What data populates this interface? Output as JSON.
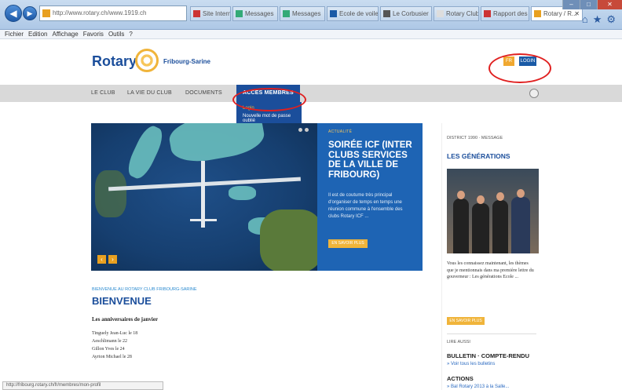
{
  "browser": {
    "address": "http://www.rotary.ch/www.1919.ch",
    "tabs": [
      {
        "label": "Site Internet",
        "active": false
      },
      {
        "label": "Messages",
        "active": false
      },
      {
        "label": "Messages",
        "active": false
      },
      {
        "label": "Ecole de voile",
        "active": false
      },
      {
        "label": "Le Corbusier",
        "active": false
      },
      {
        "label": "Rotary Club",
        "active": false
      },
      {
        "label": "Rapport des",
        "active": false
      },
      {
        "label": "Rotary / R...",
        "active": true
      }
    ],
    "menu": [
      "Fichier",
      "Edition",
      "Affichage",
      "Favoris",
      "Outils",
      "?"
    ],
    "window_controls": [
      "–",
      "□",
      "✕"
    ],
    "right_icons": [
      "home-icon",
      "star-icon",
      "gear-icon"
    ],
    "status_text": "http://fribourg.rotary.ch/fr/membres/mon-profil"
  },
  "site": {
    "logo_text": "Rotary",
    "logo_club": "Fribourg-Sarine",
    "lang": "FR",
    "login_label": "LOGIN",
    "nav": [
      {
        "label": "LE CLUB",
        "active": false
      },
      {
        "label": "LA VIE DU CLUB",
        "active": false
      },
      {
        "label": "DOCUMENTS",
        "active": false
      },
      {
        "label": "ACCÈS MEMBRES",
        "active": true
      }
    ],
    "dropdown": {
      "item1": "Login",
      "item2": "Nouvelle mot de passe oublié"
    },
    "hero": {
      "kicker": "ACTUALITÉ",
      "title": "SOIRÉE ICF (INTER CLUBS SERVICES DE LA VILLE DE FRIBOURG)",
      "text": "Il est de coutume très principal d'organiser de temps en temps une réunion commune à l'ensemble des clubs Rotary ICF ...",
      "button": "EN SAVOIR PLUS",
      "prev": "‹",
      "next": "›"
    },
    "welcome": {
      "kicker": "BIENVENUE AU ROTARY CLUB FRIBOURG-SARINE",
      "title": "BIENVENUE",
      "bold_line": "Les anniversaires de janvier",
      "birthdays": [
        "Tinguely Jean-Luc le 18",
        "Aeschlimann le 22",
        "Gillon Yves le 24",
        "Ayrton Michael le 28"
      ]
    },
    "sidebar": {
      "kicker": "DISTRICT 1990 · MESSAGE",
      "title": "LES GÉNÉRATIONS",
      "text": "Vous les connaissez maintenant, les thèmes que je mentionnais dans ma première lettre du gouverneur : Les générations Ecole ...",
      "button": "EN SAVOIR PLUS",
      "lire_label": "LIRE AUSSI",
      "bulletin_title": "BULLETIN · COMPTE-RENDU",
      "bulletin_link": "» Voir tous les bulletins",
      "actions_title": "ACTIONS",
      "actions_link": "» Bal Rotary 2013 à la Salle..."
    }
  }
}
